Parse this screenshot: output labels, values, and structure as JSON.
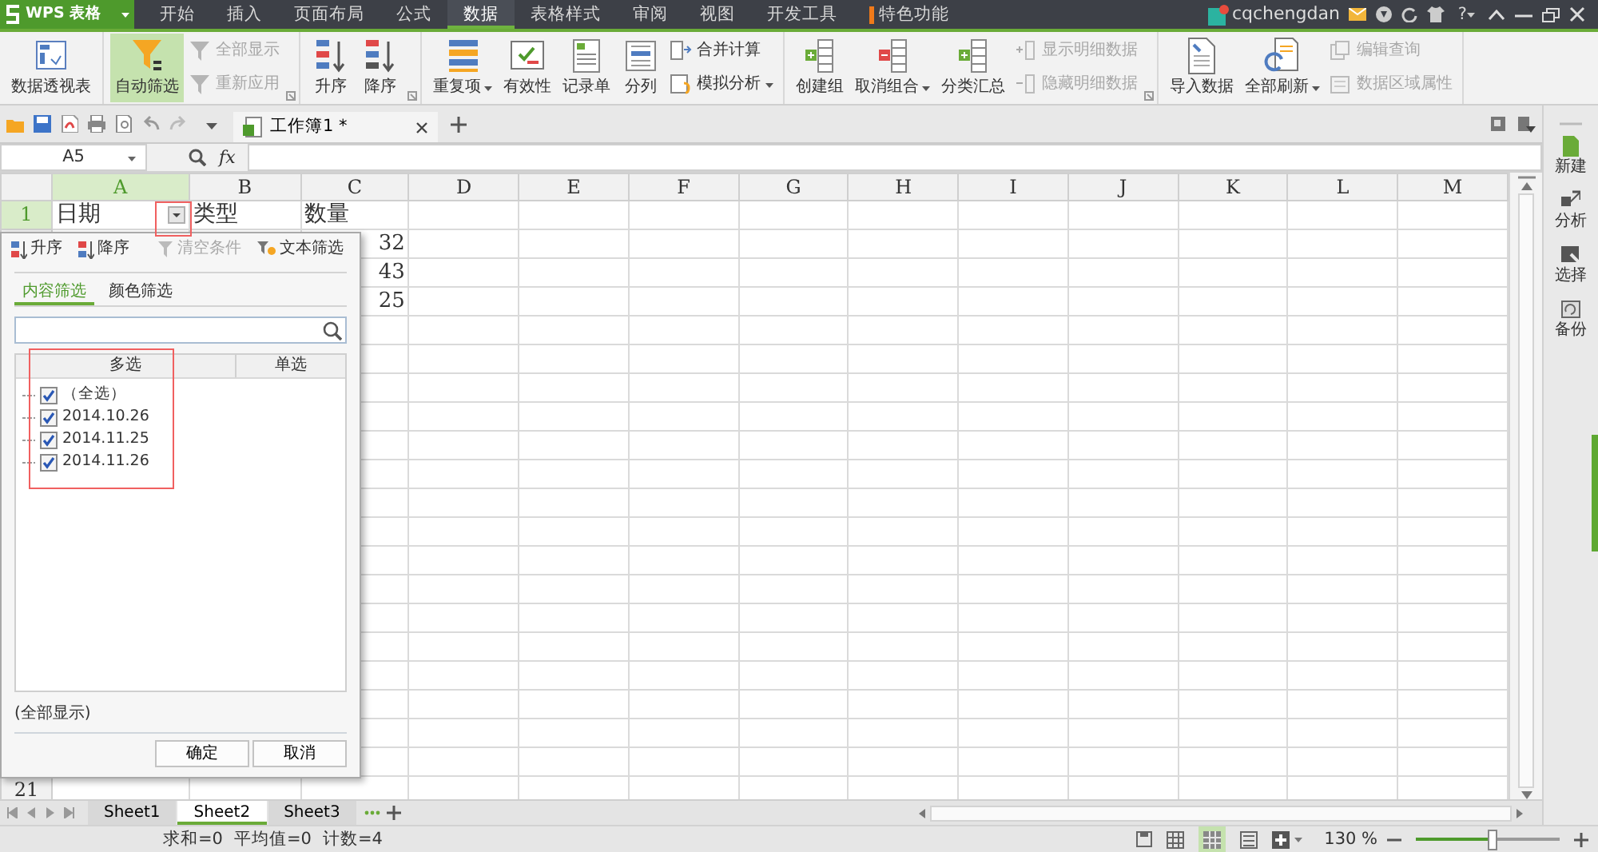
{
  "app": {
    "name": "WPS 表格"
  },
  "menu_tabs": [
    {
      "label": "开始",
      "selected": false,
      "kind": "plain"
    },
    {
      "label": "插入",
      "selected": false,
      "kind": "plain"
    },
    {
      "label": "页面布局",
      "selected": false,
      "kind": "plain"
    },
    {
      "label": "公式",
      "selected": false,
      "kind": "plain"
    },
    {
      "label": "数据",
      "selected": true,
      "kind": "plain"
    },
    {
      "label": "表格样式",
      "selected": false,
      "kind": "plain"
    },
    {
      "label": "审阅",
      "selected": false,
      "kind": "plain"
    },
    {
      "label": "视图",
      "selected": false,
      "kind": "plain"
    },
    {
      "label": "开发工具",
      "selected": false,
      "kind": "plain"
    },
    {
      "label": "特色功能",
      "selected": false,
      "kind": "featured"
    }
  ],
  "account": {
    "user": "cqchengdan",
    "help": "?"
  },
  "ribbon": {
    "groups": [
      {
        "launcher": false,
        "items": [
          {
            "label": "数据透视表",
            "kind": "large",
            "on": false,
            "disabled": false,
            "dropdown": false
          }
        ]
      },
      {
        "launcher": true,
        "items": [
          {
            "label": "自动筛选",
            "kind": "large",
            "on": true,
            "disabled": false,
            "dropdown": false
          },
          {
            "label": "全部显示",
            "kind": "small",
            "on": false,
            "disabled": true,
            "dropdown": false
          },
          {
            "label": "重新应用",
            "kind": "small",
            "on": false,
            "disabled": true,
            "dropdown": false
          }
        ]
      },
      {
        "launcher": true,
        "items": [
          {
            "label": "升序",
            "kind": "large",
            "on": false,
            "disabled": false,
            "dropdown": false
          },
          {
            "label": "降序",
            "kind": "large",
            "on": false,
            "disabled": false,
            "dropdown": false
          }
        ]
      },
      {
        "launcher": false,
        "items": [
          {
            "label": "重复项",
            "kind": "large",
            "on": false,
            "disabled": false,
            "dropdown": true
          },
          {
            "label": "有效性",
            "kind": "large",
            "on": false,
            "disabled": false,
            "dropdown": false
          },
          {
            "label": "记录单",
            "kind": "large",
            "on": false,
            "disabled": false,
            "dropdown": false
          },
          {
            "label": "分列",
            "kind": "large",
            "on": false,
            "disabled": false,
            "dropdown": false
          },
          {
            "label": "合并计算",
            "kind": "small",
            "on": false,
            "disabled": false,
            "dropdown": false
          },
          {
            "label": "模拟分析",
            "kind": "small",
            "on": false,
            "disabled": false,
            "dropdown": true
          }
        ]
      },
      {
        "launcher": true,
        "items": [
          {
            "label": "创建组",
            "kind": "large",
            "on": false,
            "disabled": false,
            "dropdown": false
          },
          {
            "label": "取消组合",
            "kind": "large",
            "on": false,
            "disabled": false,
            "dropdown": true
          },
          {
            "label": "分类汇总",
            "kind": "large",
            "on": false,
            "disabled": false,
            "dropdown": false
          },
          {
            "label": "显示明细数据",
            "kind": "small",
            "on": false,
            "disabled": true,
            "dropdown": false
          },
          {
            "label": "隐藏明细数据",
            "kind": "small",
            "on": false,
            "disabled": true,
            "dropdown": false
          }
        ]
      },
      {
        "launcher": false,
        "items": [
          {
            "label": "导入数据",
            "kind": "large",
            "on": false,
            "disabled": false,
            "dropdown": false
          },
          {
            "label": "全部刷新",
            "kind": "large",
            "on": false,
            "disabled": false,
            "dropdown": true
          },
          {
            "label": "编辑查询",
            "kind": "small",
            "on": false,
            "disabled": true,
            "dropdown": false
          },
          {
            "label": "数据区域属性",
            "kind": "small",
            "on": false,
            "disabled": true,
            "dropdown": false
          }
        ]
      }
    ]
  },
  "document_tab": {
    "title": "工作簿1 *"
  },
  "formula_bar": {
    "cell_reference": "A5",
    "function_label": "fx"
  },
  "sheet": {
    "columns": [
      {
        "label": "A",
        "selected": true
      },
      {
        "label": "B",
        "selected": false
      },
      {
        "label": "C",
        "selected": false
      },
      {
        "label": "D",
        "selected": false
      },
      {
        "label": "E",
        "selected": false
      },
      {
        "label": "F",
        "selected": false
      },
      {
        "label": "G",
        "selected": false
      },
      {
        "label": "H",
        "selected": false
      },
      {
        "label": "I",
        "selected": false
      },
      {
        "label": "J",
        "selected": false
      },
      {
        "label": "K",
        "selected": false
      },
      {
        "label": "L",
        "selected": false
      },
      {
        "label": "M",
        "selected": false
      }
    ],
    "rows": [
      {
        "header": "1",
        "selected": true,
        "filter_dropdown": true,
        "cells": [
          "日期",
          "类型",
          "数量"
        ]
      },
      {
        "cells": [
          null,
          null,
          "32"
        ]
      },
      {
        "cells": [
          null,
          null,
          "43"
        ]
      },
      {
        "cells": [
          null,
          null,
          "25"
        ]
      }
    ],
    "last_row_header": "21"
  },
  "filter_popup": {
    "sort_buttons": [
      "升序",
      "降序"
    ],
    "tools": [
      {
        "label": "清空条件",
        "disabled": true
      },
      {
        "label": "文本筛选",
        "disabled": false
      }
    ],
    "tabs": [
      {
        "label": "内容筛选",
        "selected": true
      },
      {
        "label": "颜色筛选",
        "selected": false
      }
    ],
    "list_columns": [
      "多选",
      "单选"
    ],
    "items": [
      {
        "label": "（全选）",
        "checked": true
      },
      {
        "label": "2014.10.26",
        "checked": true
      },
      {
        "label": "2014.11.25",
        "checked": true
      },
      {
        "label": "2014.11.26",
        "checked": true
      }
    ],
    "summary": "(全部显示)",
    "buttons": [
      "确定",
      "取消"
    ]
  },
  "sheet_tabs": [
    {
      "label": "Sheet1",
      "selected": false
    },
    {
      "label": "Sheet2",
      "selected": true
    },
    {
      "label": "Sheet3",
      "selected": false
    }
  ],
  "side_panel": {
    "items": [
      "新建",
      "分析",
      "选择",
      "备份"
    ]
  },
  "status_bar": {
    "stats": [
      "求和=0",
      "平均值=0",
      "计数=4"
    ],
    "view_modes": [
      {
        "selected": false
      },
      {
        "selected": true
      },
      {
        "selected": false
      }
    ],
    "zoom": "130 %",
    "zoom_slider": {
      "level": 0.53
    }
  }
}
